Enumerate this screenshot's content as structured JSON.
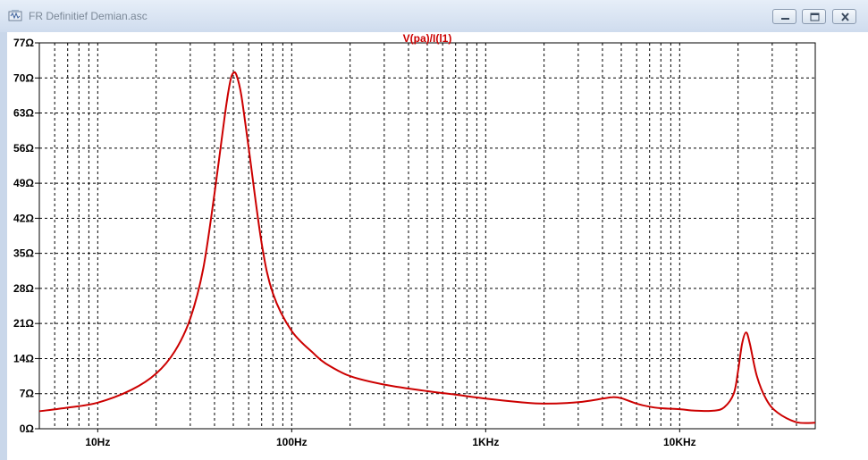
{
  "window": {
    "title": "FR Definitief Demian.asc",
    "icons": {
      "app": "schematic-icon",
      "minimize": "minimize-icon",
      "restore": "restore-icon",
      "close": "close-icon"
    },
    "colors": {
      "accent": "#cc0000",
      "grid": "#000000",
      "axis_text": "#000000"
    }
  },
  "chart_data": {
    "type": "line",
    "title": "V(pa)/I(l1)",
    "xlabel": "",
    "ylabel": "",
    "x_scale": "log",
    "xlim": [
      5,
      50000
    ],
    "ylim": [
      0,
      77
    ],
    "grid": true,
    "x_ticks": [
      {
        "value": 10,
        "label": "10Hz"
      },
      {
        "value": 100,
        "label": "100Hz"
      },
      {
        "value": 1000,
        "label": "1KHz"
      },
      {
        "value": 10000,
        "label": "10KHz"
      }
    ],
    "y_ticks": [
      {
        "value": 0,
        "label": "0Ω"
      },
      {
        "value": 7,
        "label": "7Ω"
      },
      {
        "value": 14,
        "label": "14Ω"
      },
      {
        "value": 21,
        "label": "21Ω"
      },
      {
        "value": 28,
        "label": "28Ω"
      },
      {
        "value": 35,
        "label": "35Ω"
      },
      {
        "value": 42,
        "label": "42Ω"
      },
      {
        "value": 49,
        "label": "49Ω"
      },
      {
        "value": 56,
        "label": "56Ω"
      },
      {
        "value": 63,
        "label": "63Ω"
      },
      {
        "value": 70,
        "label": "70Ω"
      },
      {
        "value": 77,
        "label": "77Ω"
      }
    ],
    "series": [
      {
        "color": "#cc0000",
        "x": [
          5,
          7,
          10,
          15,
          20,
          25,
          30,
          35,
          40,
          45,
          48,
          50,
          52,
          55,
          60,
          70,
          80,
          100,
          130,
          150,
          200,
          300,
          500,
          700,
          1000,
          1500,
          2000,
          3000,
          4000,
          4500,
          5000,
          6000,
          7000,
          8000,
          10000,
          12000,
          15000,
          17000,
          19000,
          20000,
          21000,
          22000,
          23000,
          25000,
          28000,
          32000,
          40000,
          50000
        ],
        "values": [
          3.5,
          4.2,
          5.2,
          7.8,
          11.0,
          15.5,
          22.0,
          32.0,
          47.0,
          62.0,
          69.0,
          71.0,
          70.5,
          66.5,
          56.0,
          37.0,
          27.0,
          19.5,
          15.0,
          13.0,
          10.5,
          8.8,
          7.5,
          6.8,
          6.0,
          5.3,
          5.0,
          5.3,
          6.0,
          6.3,
          6.1,
          5.0,
          4.4,
          4.1,
          3.9,
          3.6,
          3.6,
          4.3,
          7.0,
          11.5,
          17.0,
          19.2,
          17.0,
          10.5,
          5.8,
          3.2,
          1.3,
          1.2
        ]
      }
    ]
  }
}
